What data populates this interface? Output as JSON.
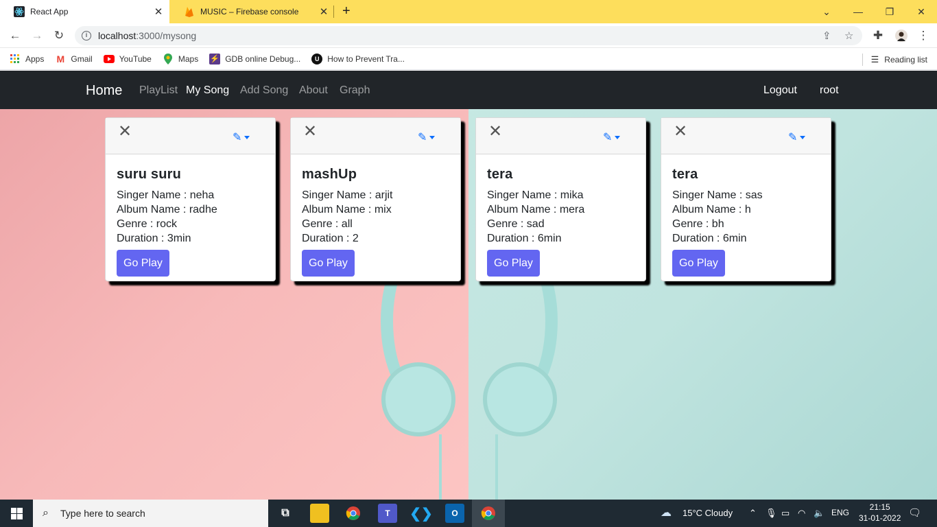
{
  "browser": {
    "tabs": [
      {
        "title": "React App",
        "icon": "react-icon"
      },
      {
        "title": "MUSIC – Firebase console",
        "icon": "firebase-icon"
      }
    ],
    "url_host": "localhost",
    "url_path": ":3000/mysong",
    "bookmarks": [
      "Apps",
      "Gmail",
      "YouTube",
      "Maps",
      "GDB online Debug...",
      "How to Prevent Tra..."
    ],
    "reading_list": "Reading list"
  },
  "navbar": {
    "brand": "Home",
    "links": [
      "PlayList",
      "My Song",
      "Add Song",
      "About",
      "Graph"
    ],
    "active_link": "My Song",
    "logout": "Logout",
    "user": "root"
  },
  "songs": [
    {
      "title": "suru suru",
      "singer": "Singer Name : neha",
      "album": "Album Name : radhe",
      "genre": "Genre : rock",
      "duration": "Duration : 3min",
      "button": "Go Play"
    },
    {
      "title": "mashUp",
      "singer": "Singer Name : arjit",
      "album": "Album Name : mix",
      "genre": "Genre : all",
      "duration": "Duration : 2",
      "button": "Go Play"
    },
    {
      "title": "tera",
      "singer": "Singer Name : mika",
      "album": "Album Name : mera",
      "genre": "Genre : sad",
      "duration": "Duration : 6min",
      "button": "Go Play"
    },
    {
      "title": "tera",
      "singer": "Singer Name : sas",
      "album": "Album Name : h",
      "genre": "Genre : bh",
      "duration": "Duration : 6min",
      "button": "Go Play"
    }
  ],
  "taskbar": {
    "search_placeholder": "Type here to search",
    "weather": "15°C  Cloudy",
    "lang": "ENG",
    "time": "21:15",
    "date": "31-01-2022"
  },
  "colors": {
    "navbar": "#212529",
    "button": "#6366f1",
    "tabstrip": "#fdde5c",
    "edit_icon": "#0d6efd"
  }
}
